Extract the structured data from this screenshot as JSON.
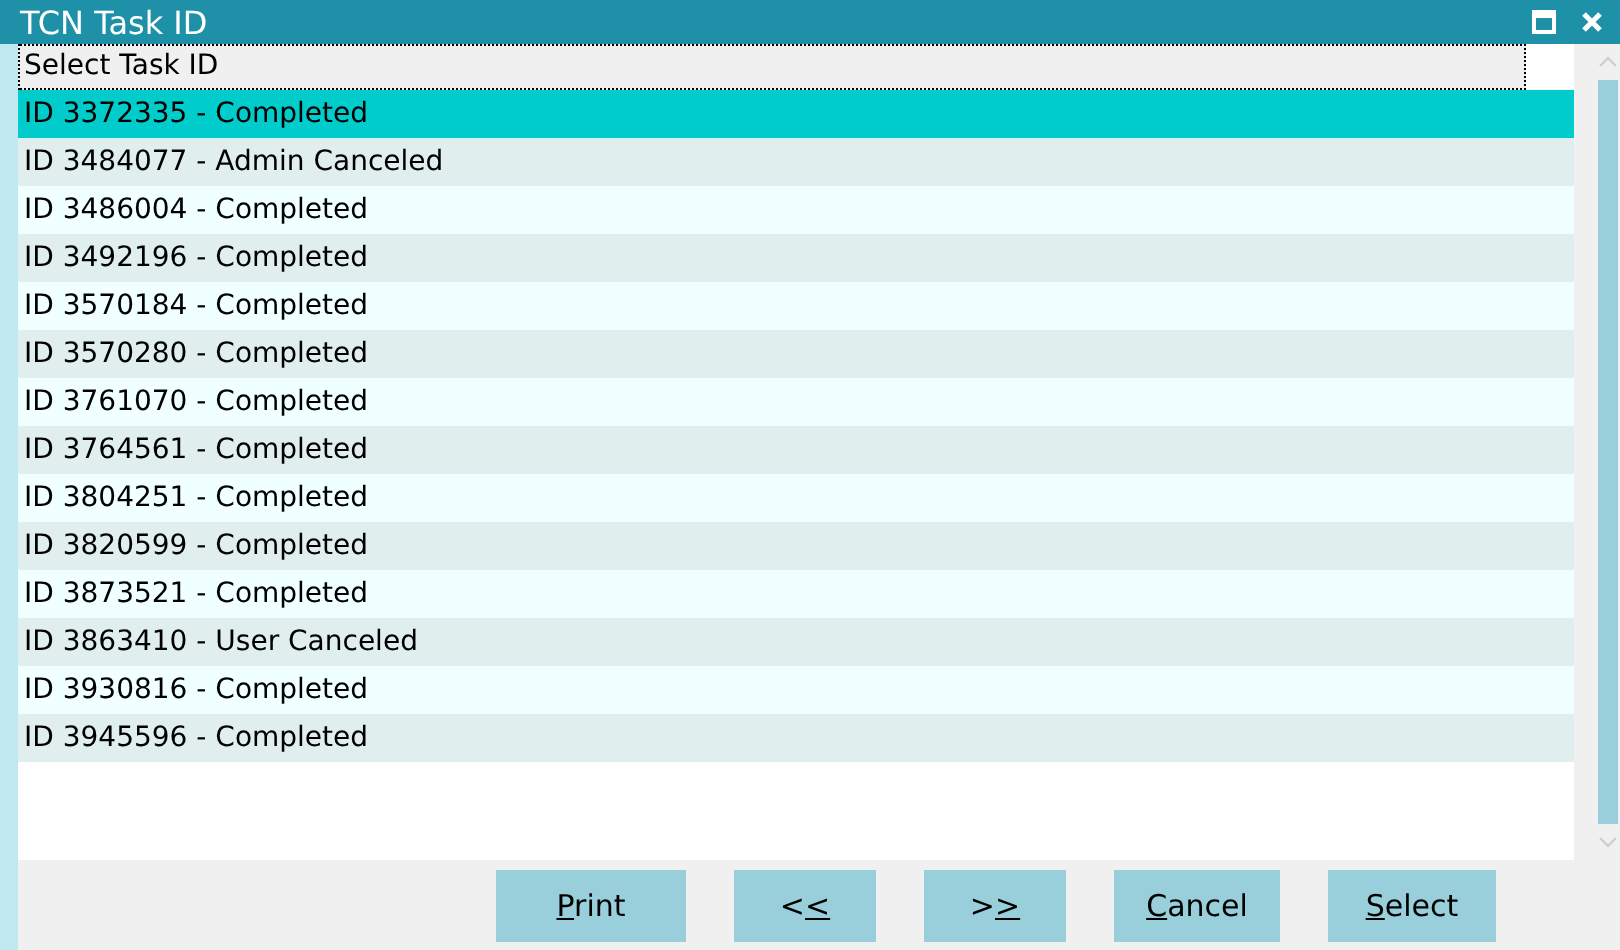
{
  "window": {
    "title": "TCN Task ID"
  },
  "list": {
    "header": "Select Task ID",
    "items": [
      {
        "label": "ID 3372335 - Completed",
        "selected": true
      },
      {
        "label": "ID 3484077 - Admin Canceled",
        "selected": false
      },
      {
        "label": "ID 3486004 - Completed",
        "selected": false
      },
      {
        "label": "ID 3492196 - Completed",
        "selected": false
      },
      {
        "label": "ID 3570184 - Completed",
        "selected": false
      },
      {
        "label": "ID 3570280 - Completed",
        "selected": false
      },
      {
        "label": "ID 3761070 - Completed",
        "selected": false
      },
      {
        "label": "ID 3764561 - Completed",
        "selected": false
      },
      {
        "label": "ID 3804251 - Completed",
        "selected": false
      },
      {
        "label": "ID 3820599 - Completed",
        "selected": false
      },
      {
        "label": "ID 3873521 - Completed",
        "selected": false
      },
      {
        "label": "ID 3863410 - User Canceled",
        "selected": false
      },
      {
        "label": "ID 3930816 - Completed",
        "selected": false
      },
      {
        "label": "ID 3945596 - Completed",
        "selected": false
      }
    ]
  },
  "buttons": [
    {
      "key": "P",
      "after": "rint"
    },
    {
      "before": "<",
      "key": "<"
    },
    {
      "before": ">",
      "key": ">"
    },
    {
      "key": "C",
      "after": "ancel"
    },
    {
      "key": "S",
      "after": "elect"
    }
  ]
}
